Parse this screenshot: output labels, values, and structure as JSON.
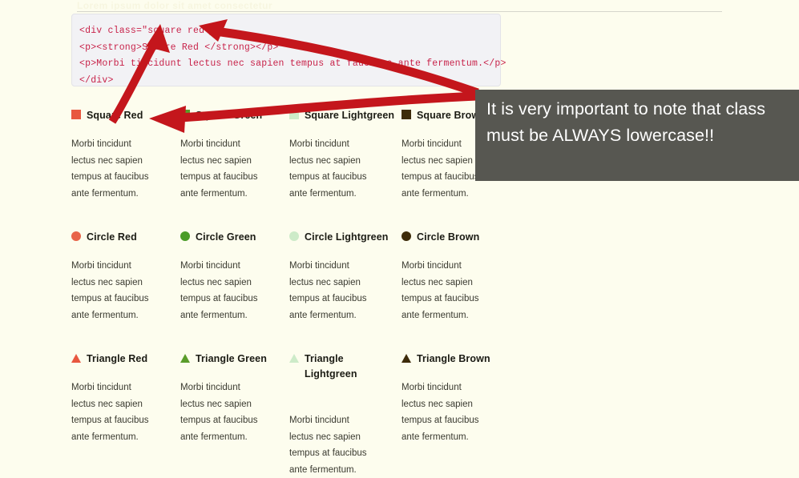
{
  "page": {
    "background_color": "#fdfdee",
    "ghost_header": "Lorem ipsum dolor sit amet consectetur"
  },
  "code_block": {
    "background_color": "#f2f2f5",
    "text_color": "#c8234a",
    "lines": [
      "<div class=\"square red\">",
      "<p><strong>Square Red </strong></p>",
      "<p>Morbi tincidunt lectus nec sapien tempus at faucibus ante fermentum.</p>",
      "</div>"
    ]
  },
  "annotation": {
    "tooltip_text": "It is very important to note that class must be ALWAYS lowercase!!",
    "tooltip_background": "#575751",
    "tooltip_text_color": "#ffffff",
    "arrow_color": "#c4161c"
  },
  "body_text": "Morbi tincidunt lectus nec sapien tempus at faucibus ante fermentum.",
  "colors": {
    "red": "#e8573f",
    "green": "#59a02a",
    "lightgreen": "#cdebc8",
    "brown": "#3d2b0a",
    "circle_red": "#e8644a",
    "circle_green": "#4a9c28",
    "triangle_red": "#e8573f",
    "triangle_green": "#5a9c2a"
  },
  "rows": [
    {
      "shape": "square",
      "items": [
        {
          "label": "Square Red",
          "color": "#e8573f",
          "body": "Morbi tincidunt lectus nec sapien tempus at faucibus ante fermentum."
        },
        {
          "label": "Square Green",
          "color": "#59a02a",
          "body": "Morbi tincidunt lectus nec sapien tempus at faucibus ante fermentum."
        },
        {
          "label": "Square Lightgreen",
          "color": "#cdebc8",
          "body": "Morbi tincidunt lectus nec sapien tempus at faucibus ante fermentum."
        },
        {
          "label": "Square Brown",
          "color": "#3d2b0a",
          "body": "Morbi tincidunt lectus nec sapien tempus at faucibus ante fermentum."
        }
      ]
    },
    {
      "shape": "circle",
      "items": [
        {
          "label": "Circle Red",
          "color": "#e8644a",
          "body": "Morbi tincidunt lectus nec sapien tempus at faucibus ante fermentum."
        },
        {
          "label": "Circle Green",
          "color": "#4a9c28",
          "body": "Morbi tincidunt lectus nec sapien tempus at faucibus ante fermentum."
        },
        {
          "label": "Circle Lightgreen",
          "color": "#cdebc8",
          "body": "Morbi tincidunt lectus nec sapien tempus at faucibus ante fermentum."
        },
        {
          "label": "Circle Brown",
          "color": "#3d2b0a",
          "body": "Morbi tincidunt lectus nec sapien tempus at faucibus ante fermentum."
        }
      ]
    },
    {
      "shape": "triangle",
      "items": [
        {
          "label": "Triangle Red",
          "color": "#e8573f",
          "body": "Morbi tincidunt lectus nec sapien tempus at faucibus ante fermentum."
        },
        {
          "label": "Triangle Green",
          "color": "#5a9c2a",
          "body": "Morbi tincidunt lectus nec sapien tempus at faucibus ante fermentum."
        },
        {
          "label": "Triangle Lightgreen",
          "color": "#cdebc8",
          "body": "Morbi tincidunt lectus nec sapien tempus at faucibus ante fermentum."
        },
        {
          "label": "Triangle Brown",
          "color": "#3d2b0a",
          "body": "Morbi tincidunt lectus nec sapien tempus at faucibus ante fermentum."
        }
      ]
    }
  ]
}
